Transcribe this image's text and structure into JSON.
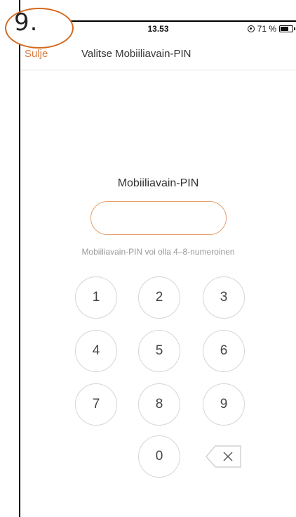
{
  "annotation": {
    "step_number": "9."
  },
  "status_bar": {
    "time": "13.53",
    "battery_text": "71 %",
    "battery_level": 0.71
  },
  "nav": {
    "close_label": "Sulje",
    "title": "Valitse Mobiiliavain-PIN"
  },
  "pin": {
    "label": "Mobiiliavain-PIN",
    "value": "",
    "hint": "Mobiiliavain-PIN voi olla 4–8-numeroinen"
  },
  "keypad": {
    "keys": [
      "1",
      "2",
      "3",
      "4",
      "5",
      "6",
      "7",
      "8",
      "9",
      "0"
    ],
    "backspace_icon": "backspace-icon"
  },
  "colors": {
    "accent": "#d9793a",
    "input_border": "#e8a06b",
    "hint": "#9a9a9a",
    "annotation_circle": "#d46a1f"
  }
}
